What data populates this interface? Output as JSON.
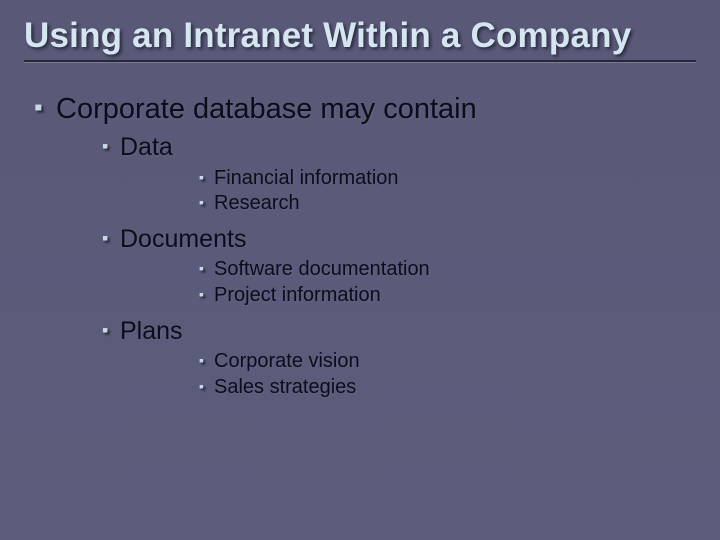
{
  "title": "Using an Intranet Within a Company",
  "bullets": {
    "l1": "Corporate database may contain",
    "groups": [
      {
        "label": "Data",
        "items": [
          "Financial information",
          "Research"
        ]
      },
      {
        "label": "Documents",
        "items": [
          "Software documentation",
          "Project information"
        ]
      },
      {
        "label": "Plans",
        "items": [
          "Corporate vision",
          "Sales strategies"
        ]
      }
    ]
  }
}
